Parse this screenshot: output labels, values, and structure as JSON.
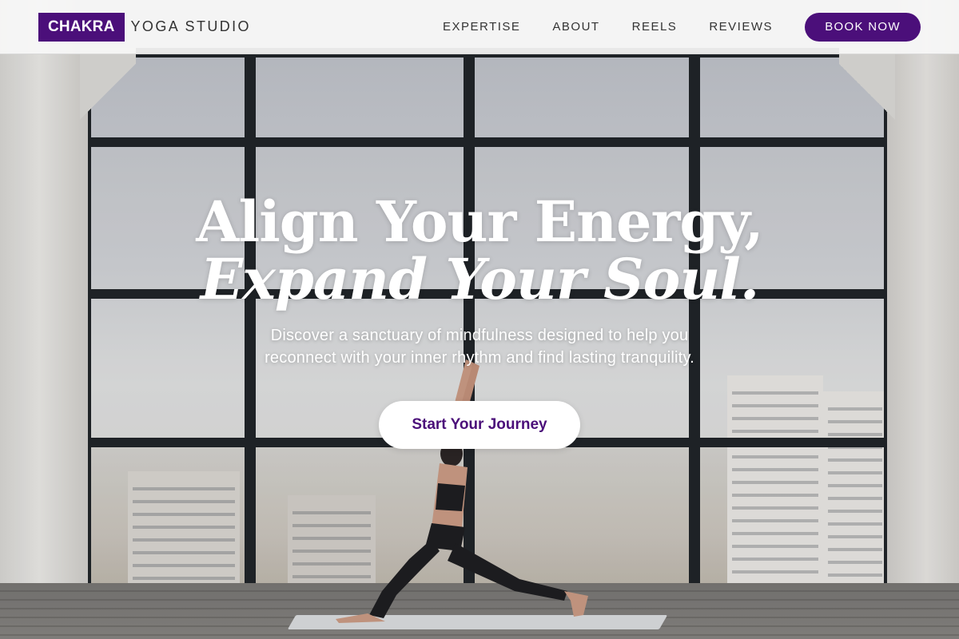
{
  "brand": {
    "logo_box": "CHAKRA",
    "logo_text": "YOGA STUDIO",
    "accent_color": "#4b0f7a"
  },
  "nav": {
    "links": [
      "EXPERTISE",
      "ABOUT",
      "REELS",
      "REVIEWS"
    ],
    "book_label": "BOOK NOW"
  },
  "hero": {
    "headline_line1": "Align Your Energy,",
    "headline_line2": "Expand Your Soul.",
    "subtitle_line1": "Discover a sanctuary of mindfulness designed to help you",
    "subtitle_line2": "reconnect with your inner rhythm and find lasting tranquility.",
    "cta_label": "Start Your Journey",
    "background_image": "yoga-studio-photo"
  }
}
